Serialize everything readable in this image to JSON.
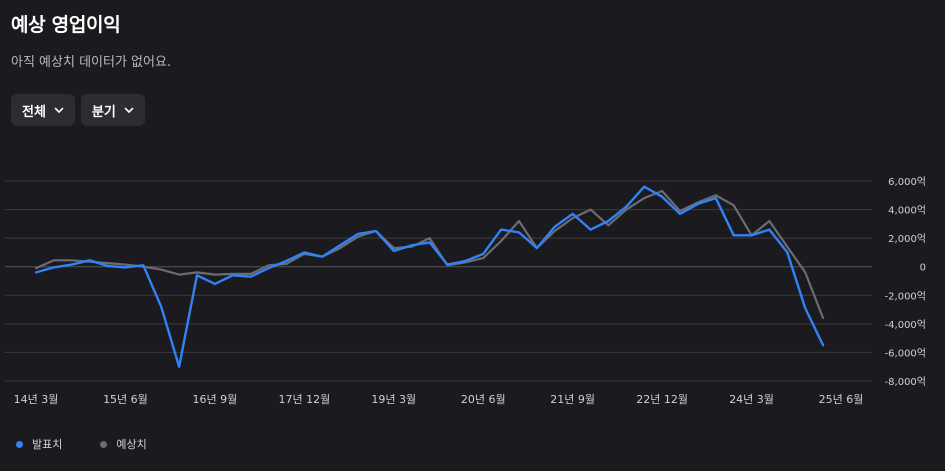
{
  "header": {
    "title": "예상 영업이익",
    "subtitle": "아직 예상치 데이터가 없어요."
  },
  "filters": [
    {
      "label": "전체",
      "icon": "chevron-down-icon"
    },
    {
      "label": "분기",
      "icon": "chevron-down-icon"
    }
  ],
  "legend": [
    {
      "label": "발표치",
      "color": "#3182f6"
    },
    {
      "label": "예상치",
      "color": "#6b6c72"
    }
  ],
  "chart_data": {
    "type": "line",
    "ylim": [
      -8000,
      6000
    ],
    "yticks": [
      6000,
      4000,
      2000,
      0,
      -2000,
      -4000,
      -6000,
      -8000
    ],
    "ytick_labels": [
      "6,000억",
      "4,000억",
      "2,000억",
      "0",
      "-2,000억",
      "-4,000억",
      "-6,000억",
      "-8,000억"
    ],
    "x_labels": [
      {
        "label": "14년 3월",
        "i": 0
      },
      {
        "label": "15년 6월",
        "i": 5
      },
      {
        "label": "16년 9월",
        "i": 10
      },
      {
        "label": "17년 12월",
        "i": 15
      },
      {
        "label": "19년 3월",
        "i": 20
      },
      {
        "label": "20년 6월",
        "i": 25
      },
      {
        "label": "21년 9월",
        "i": 30
      },
      {
        "label": "22년 12월",
        "i": 35
      },
      {
        "label": "24년 3월",
        "i": 40
      },
      {
        "label": "25년 6월",
        "i": 45
      }
    ],
    "n_points": 46,
    "series": [
      {
        "name": "발표치",
        "color": "#3182f6",
        "values": [
          -400,
          -50,
          150,
          450,
          50,
          -50,
          100,
          -2800,
          -7000,
          -600,
          -1200,
          -600,
          -700,
          -100,
          400,
          1000,
          700,
          1500,
          2300,
          2500,
          1100,
          1500,
          1700,
          150,
          400,
          900,
          2600,
          2400,
          1300,
          2800,
          3700,
          2600,
          3200,
          4200,
          5600,
          4900,
          3700,
          4400,
          4800,
          2200,
          2200,
          2600,
          1000,
          -2900,
          -5500
        ]
      },
      {
        "name": "예상치",
        "color": "#6b6c72",
        "values": [
          -100,
          450,
          450,
          350,
          250,
          150,
          0,
          -200,
          -550,
          -400,
          -550,
          -500,
          -500,
          100,
          200,
          900,
          700,
          1300,
          2100,
          2500,
          1300,
          1400,
          2000,
          100,
          300,
          600,
          1800,
          3200,
          1300,
          2500,
          3400,
          4000,
          2900,
          4000,
          4800,
          5300,
          3900,
          4500,
          5000,
          4300,
          2200,
          3200,
          1400,
          -400,
          -3600
        ]
      }
    ]
  }
}
